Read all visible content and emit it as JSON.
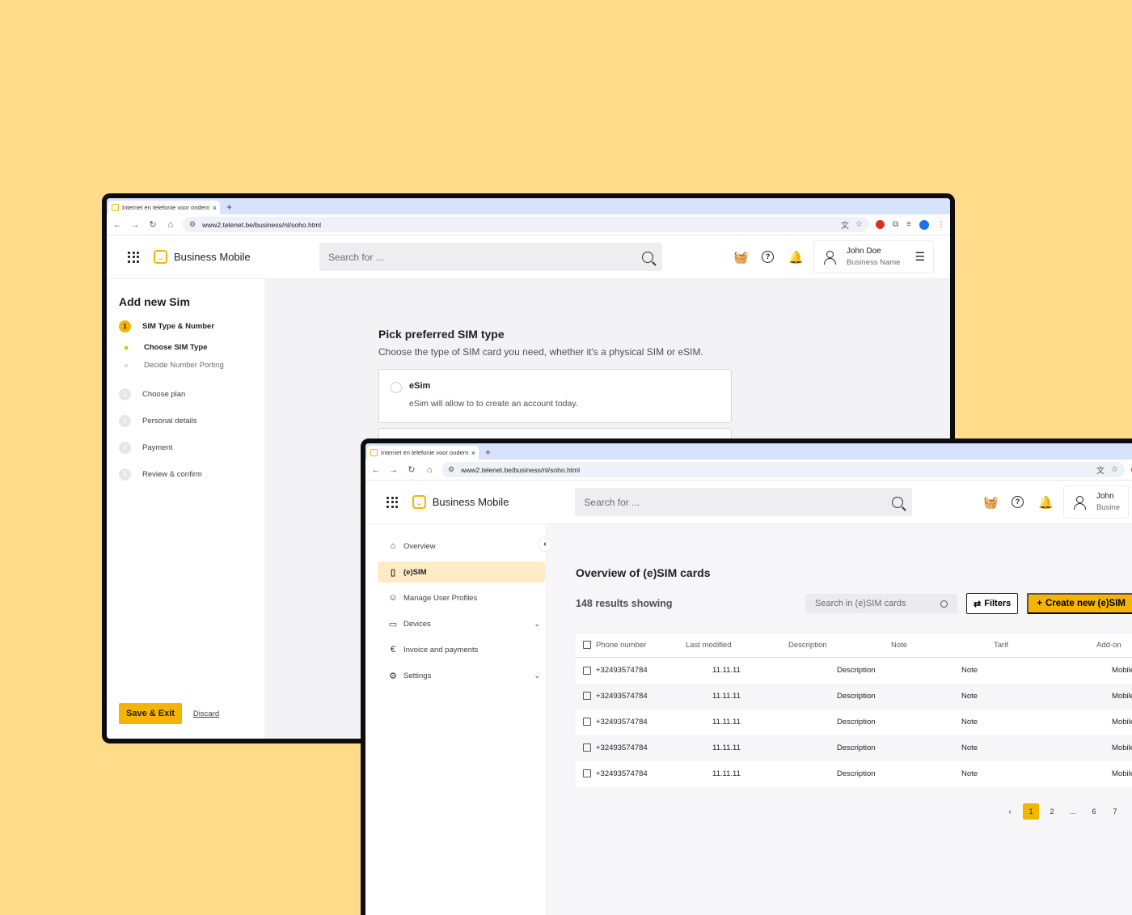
{
  "browser": {
    "tab_title": "Internet en telefonie voor ondernemers",
    "new_tab": "+",
    "tab_close": "×",
    "url": "www2.telenet.be/business/nl/soho.html"
  },
  "header": {
    "brand": "Business Mobile",
    "search_placeholder": "Search for ...",
    "user_name": "John Doe",
    "user_business": "Business Name"
  },
  "wizard": {
    "title": "Add new Sim",
    "steps": [
      {
        "num": "1",
        "label": "SIM Type & Number"
      },
      {
        "num": "2",
        "label": "Choose plan"
      },
      {
        "num": "3",
        "label": "Personal details"
      },
      {
        "num": "4",
        "label": "Payment"
      },
      {
        "num": "5",
        "label": "Review & confirm"
      }
    ],
    "substeps": [
      "Choose SIM Type",
      "Decide Number Porting"
    ],
    "save_exit": "Save & Exit",
    "discard": "Discard",
    "pick_title": "Pick preferred SIM type",
    "pick_subtitle": "Choose the type of SIM card you need, whether it's a physical SIM or eSIM.",
    "option_title": "eSim",
    "option_subtitle": "eSim will allow to to create an account today."
  },
  "front_header": {
    "user_name": "John",
    "user_business": "Busine"
  },
  "sidenav": {
    "items": [
      {
        "label": "Overview",
        "icon": "home-icon"
      },
      {
        "label": "(e)SIM",
        "icon": "sim-icon"
      },
      {
        "label": "Manage User Profiles",
        "icon": "users-icon"
      },
      {
        "label": "Devices",
        "icon": "devices-icon"
      },
      {
        "label": "Invoice and payments",
        "icon": "euro-icon"
      },
      {
        "label": "Settings",
        "icon": "gear-icon"
      }
    ]
  },
  "overview": {
    "title": "Overview of (e)SIM cards",
    "results": "148 results showing",
    "search_placeholder": "Search in (e)SIM cards",
    "filters": "Filters",
    "create": "Create new (e)SIM",
    "columns": [
      "Phone number",
      "Last modified",
      "Description",
      "Note",
      "Tarif",
      "Add-on"
    ],
    "rows": [
      {
        "phone": "+32493574784",
        "modified": "11.11.11",
        "description": "Description",
        "note": "Note",
        "tarif": "Mobile"
      },
      {
        "phone": "+32493574784",
        "modified": "11.11.11",
        "description": "Description",
        "note": "Note",
        "tarif": "Mobile"
      },
      {
        "phone": "+32493574784",
        "modified": "11.11.11",
        "description": "Description",
        "note": "Note",
        "tarif": "Mobile"
      },
      {
        "phone": "+32493574784",
        "modified": "11.11.11",
        "description": "Description",
        "note": "Note",
        "tarif": "Mobile"
      },
      {
        "phone": "+32493574784",
        "modified": "11.11.11",
        "description": "Description",
        "note": "Note",
        "tarif": "Mobile"
      }
    ],
    "pages": [
      "1",
      "2",
      "...",
      "6",
      "7"
    ]
  },
  "colors": {
    "accent": "#F5B400",
    "background": "#FFDB8A"
  }
}
